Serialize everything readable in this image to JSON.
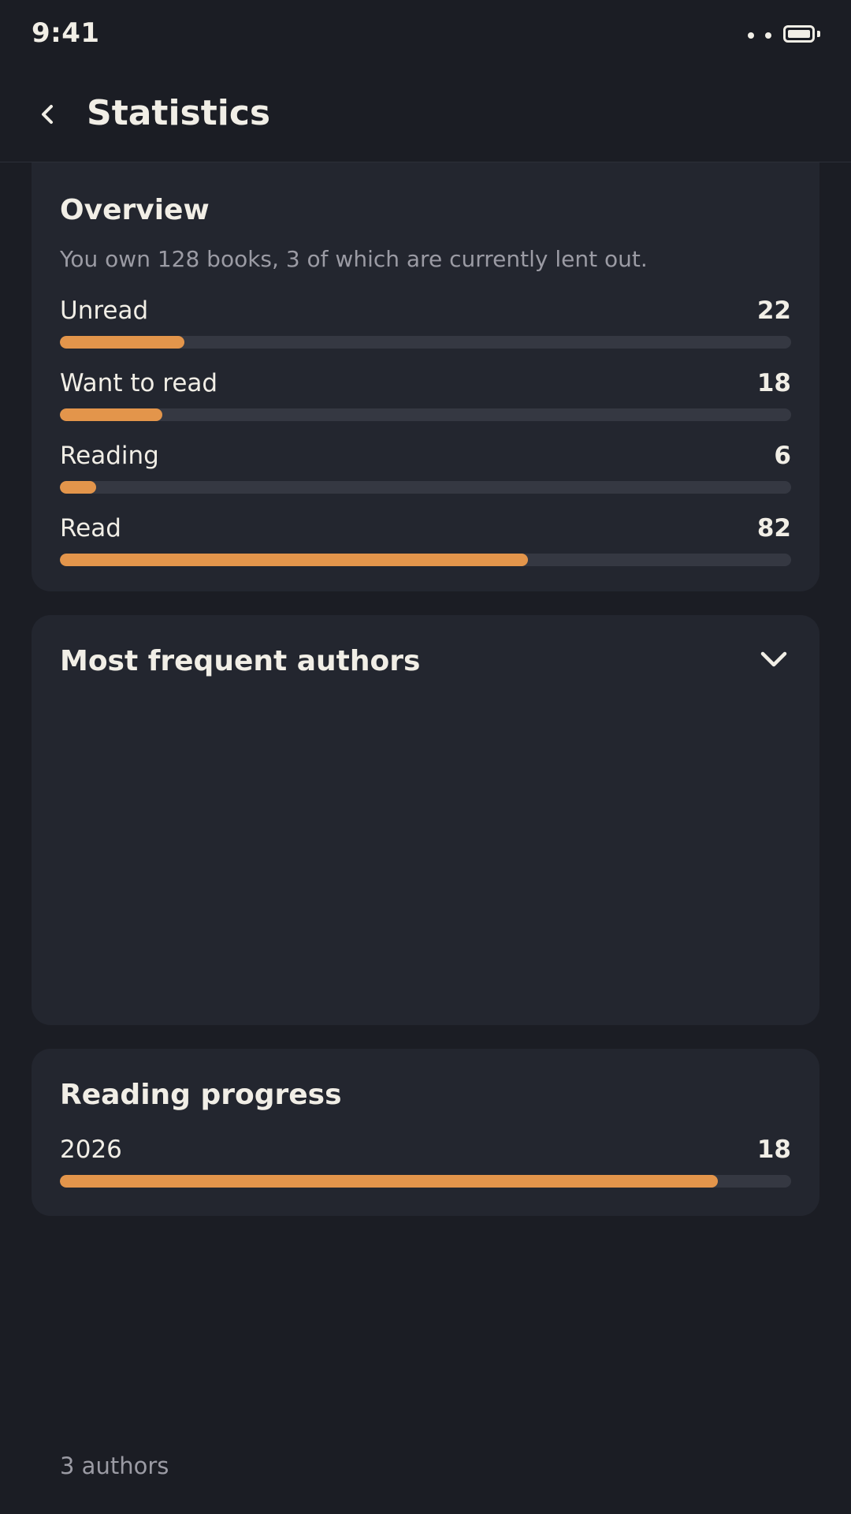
{
  "status_bar": {
    "time": "9:41"
  },
  "header": {
    "title": "Statistics",
    "back_icon": "chevron-left-icon"
  },
  "overview": {
    "title": "Overview",
    "subtitle": "You own 128 books, 3 of which are currently lent out.",
    "stats": [
      {
        "label": "Unread",
        "value": "22",
        "fraction": 0.17
      },
      {
        "label": "Want to read",
        "value": "18",
        "fraction": 0.14
      },
      {
        "label": "Reading",
        "value": "6",
        "fraction": 0.05
      },
      {
        "label": "Read",
        "value": "82",
        "fraction": 0.64
      }
    ]
  },
  "authors": {
    "title": "Most frequent authors",
    "toggle_icon": "chevron-down-icon"
  },
  "reading_progress": {
    "title": "Reading progress",
    "year": "2026",
    "value": "18",
    "fraction": 0.9
  },
  "footer": {
    "text": "3 authors"
  },
  "colors": {
    "background": "#1b1d24",
    "card": "#23262f",
    "accent": "#e3954b",
    "track": "#353842",
    "text": "#f1eee6",
    "muted": "#9b9ba4"
  }
}
